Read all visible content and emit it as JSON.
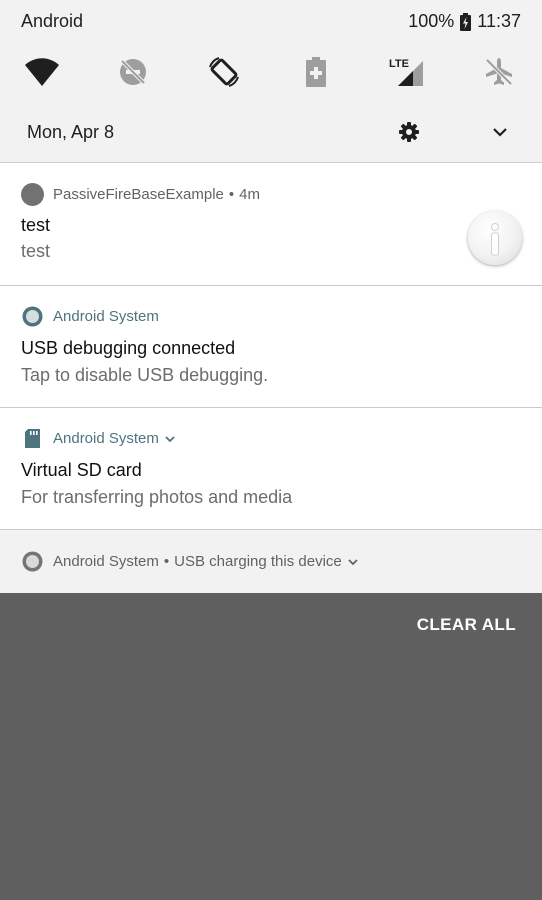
{
  "status_bar": {
    "carrier": "Android",
    "battery": "100%",
    "time": "11:37"
  },
  "quick_settings": {
    "tiles": [
      {
        "name": "wifi",
        "state": "on"
      },
      {
        "name": "do-not-disturb",
        "state": "off"
      },
      {
        "name": "auto-rotate",
        "state": "on"
      },
      {
        "name": "battery-saver",
        "state": "off"
      },
      {
        "name": "mobile-data",
        "label": "LTE",
        "state": "on"
      },
      {
        "name": "airplane-mode",
        "state": "off"
      }
    ]
  },
  "date_row": {
    "date": "Mon, Apr 8"
  },
  "notifications": [
    {
      "app": "PassiveFireBaseExample",
      "time": "4m",
      "title": "test",
      "text": "test"
    },
    {
      "app": "Android System",
      "title": "USB debugging connected",
      "text": "Tap to disable USB debugging."
    },
    {
      "app": "Android System",
      "title": "Virtual SD card",
      "text": "For transferring photos and media"
    },
    {
      "app": "Android System",
      "summary": "USB charging this device"
    }
  ],
  "actions": {
    "clear_all": "CLEAR ALL"
  },
  "colors": {
    "shade": "#f2f2f2",
    "card": "#ffffff",
    "scrim": "#5f5f5f",
    "app_accent": "#4e7480",
    "icon_inactive": "#9e9e9e",
    "icon_active": "#1f1f1f"
  }
}
